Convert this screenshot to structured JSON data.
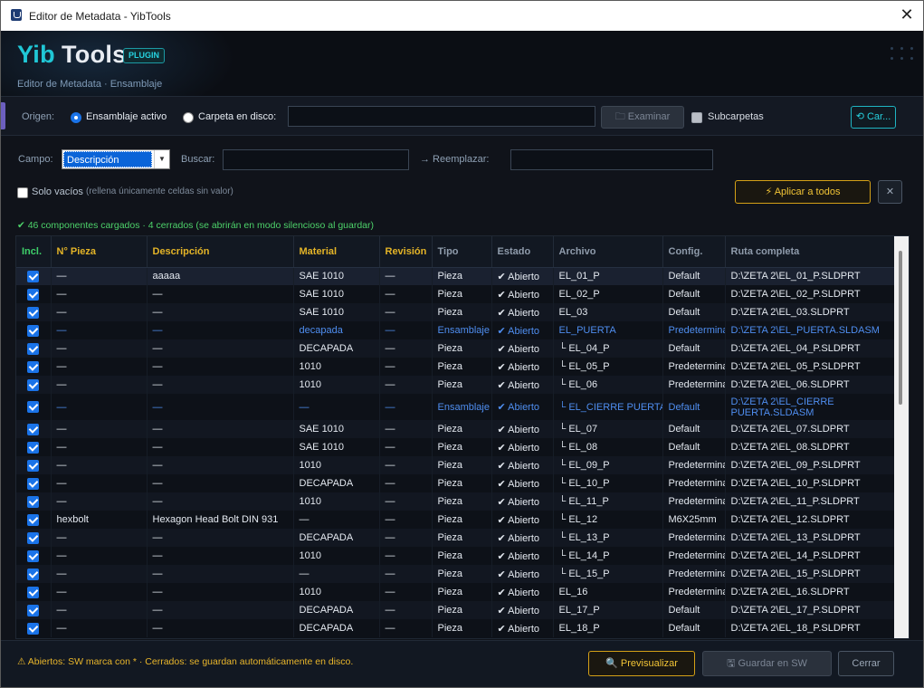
{
  "window": {
    "title": "Editor de Metadata - YibTools",
    "close_icon": "close-icon"
  },
  "header": {
    "logo_part1": "Yib",
    "logo_part2": "Tools",
    "badge": "PLUGIN",
    "subtitle": "Editor de Metadata · Ensamblaje"
  },
  "origin": {
    "label": "Origen:",
    "option_active": "Ensamblaje activo",
    "option_folder": "Carpeta en disco:",
    "selected": "Ensamblaje activo",
    "folder_value": "",
    "browse_label": "🗀 Examinar",
    "subfolders_label": "Subcarpetas",
    "subfolders_checked": false,
    "load_label": "⟲ Car..."
  },
  "field": {
    "label": "Campo:",
    "selected": "Descripción",
    "search_label": "Buscar:",
    "search_value": "",
    "replace_label": "→ Reemplazar:",
    "replace_value": "",
    "empty_only_label": "Solo vacíos",
    "empty_only_hint": "(rellena únicamente celdas sin valor)",
    "empty_only_checked": false,
    "apply_label": "⚡ Aplicar a todos",
    "clear_label": "✕"
  },
  "status": "✔  46 componentes cargados  · 4 cerrados (se abrirán en modo silencioso al guardar)",
  "table": {
    "columns": [
      "Incl.",
      "N° Pieza",
      "Descripción",
      "Material",
      "Revisión",
      "Tipo",
      "Estado",
      "Archivo",
      "Config.",
      "Ruta completa"
    ],
    "rows": [
      {
        "pieza": "—",
        "desc": "aaaaa",
        "mat": "SAE 1010",
        "rev": "—",
        "tipo": "Pieza",
        "estado": "✔ Abierto",
        "archivo": "EL_01_P",
        "config": "Default",
        "ruta": "D:\\ZETA 2\\EL_01_P.SLDPRT",
        "kind": "sel"
      },
      {
        "pieza": "—",
        "desc": "—",
        "mat": "SAE 1010",
        "rev": "—",
        "tipo": "Pieza",
        "estado": "✔ Abierto",
        "archivo": "EL_02_P",
        "config": "Default",
        "ruta": "D:\\ZETA 2\\EL_02_P.SLDPRT",
        "kind": "norm"
      },
      {
        "pieza": "—",
        "desc": "—",
        "mat": "SAE 1010",
        "rev": "—",
        "tipo": "Pieza",
        "estado": "✔ Abierto",
        "archivo": "EL_03",
        "config": "Default",
        "ruta": "D:\\ZETA 2\\EL_03.SLDPRT",
        "kind": "alt"
      },
      {
        "pieza": "—",
        "desc": "—",
        "mat": "decapada",
        "rev": "—",
        "tipo": "Ensamblaje",
        "estado": "✔ Abierto",
        "archivo": "EL_PUERTA",
        "config": "Predetermina",
        "ruta": "D:\\ZETA 2\\EL_PUERTA.SLDASM",
        "kind": "norm asm"
      },
      {
        "pieza": "—",
        "desc": "—",
        "mat": "DECAPADA",
        "rev": "—",
        "tipo": "Pieza",
        "estado": "✔ Abierto",
        "archivo": "└ EL_04_P",
        "config": "Default",
        "ruta": "D:\\ZETA 2\\EL_04_P.SLDPRT",
        "kind": "alt"
      },
      {
        "pieza": "—",
        "desc": "—",
        "mat": "1010",
        "rev": "—",
        "tipo": "Pieza",
        "estado": "✔ Abierto",
        "archivo": "└ EL_05_P",
        "config": "Predetermina",
        "ruta": "D:\\ZETA 2\\EL_05_P.SLDPRT",
        "kind": "norm"
      },
      {
        "pieza": "—",
        "desc": "—",
        "mat": "1010",
        "rev": "—",
        "tipo": "Pieza",
        "estado": "✔ Abierto",
        "archivo": "└ EL_06",
        "config": "Predetermina",
        "ruta": "D:\\ZETA 2\\EL_06.SLDPRT",
        "kind": "alt"
      },
      {
        "pieza": "—",
        "desc": "—",
        "mat": "—",
        "rev": "—",
        "tipo": "Ensamblaje",
        "estado": "✔ Abierto",
        "archivo": "└ EL_CIERRE PUERTA",
        "config": "Default",
        "ruta": "D:\\ZETA 2\\EL_CIERRE PUERTA.SLDASM",
        "kind": "norm asm tall"
      },
      {
        "pieza": "—",
        "desc": "—",
        "mat": "SAE 1010",
        "rev": "—",
        "tipo": "Pieza",
        "estado": "✔ Abierto",
        "archivo": "   └ EL_07",
        "config": "Default",
        "ruta": "D:\\ZETA 2\\EL_07.SLDPRT",
        "kind": "alt"
      },
      {
        "pieza": "—",
        "desc": "—",
        "mat": "SAE 1010",
        "rev": "—",
        "tipo": "Pieza",
        "estado": "✔ Abierto",
        "archivo": "   └ EL_08",
        "config": "Default",
        "ruta": "D:\\ZETA 2\\EL_08.SLDPRT",
        "kind": "norm"
      },
      {
        "pieza": "—",
        "desc": "—",
        "mat": "1010",
        "rev": "—",
        "tipo": "Pieza",
        "estado": "✔ Abierto",
        "archivo": "└ EL_09_P",
        "config": "Predetermina",
        "ruta": "D:\\ZETA 2\\EL_09_P.SLDPRT",
        "kind": "alt"
      },
      {
        "pieza": "—",
        "desc": "—",
        "mat": "DECAPADA",
        "rev": "—",
        "tipo": "Pieza",
        "estado": "✔ Abierto",
        "archivo": "└ EL_10_P",
        "config": "Predetermina",
        "ruta": "D:\\ZETA 2\\EL_10_P.SLDPRT",
        "kind": "norm"
      },
      {
        "pieza": "—",
        "desc": "—",
        "mat": "1010",
        "rev": "—",
        "tipo": "Pieza",
        "estado": "✔ Abierto",
        "archivo": "└ EL_11_P",
        "config": "Predetermina",
        "ruta": "D:\\ZETA 2\\EL_11_P.SLDPRT",
        "kind": "alt"
      },
      {
        "pieza": "hexbolt",
        "desc": "Hexagon Head Bolt DIN 931",
        "mat": "—",
        "rev": "—",
        "tipo": "Pieza",
        "estado": "✔ Abierto",
        "archivo": "└ EL_12",
        "config": "M6X25mm",
        "ruta": "D:\\ZETA 2\\EL_12.SLDPRT",
        "kind": "norm"
      },
      {
        "pieza": "—",
        "desc": "—",
        "mat": "DECAPADA",
        "rev": "—",
        "tipo": "Pieza",
        "estado": "✔ Abierto",
        "archivo": "└ EL_13_P",
        "config": "Predetermina",
        "ruta": "D:\\ZETA 2\\EL_13_P.SLDPRT",
        "kind": "alt"
      },
      {
        "pieza": "—",
        "desc": "—",
        "mat": "1010",
        "rev": "—",
        "tipo": "Pieza",
        "estado": "✔ Abierto",
        "archivo": "└ EL_14_P",
        "config": "Predetermina",
        "ruta": "D:\\ZETA 2\\EL_14_P.SLDPRT",
        "kind": "norm"
      },
      {
        "pieza": "—",
        "desc": "—",
        "mat": "—",
        "rev": "—",
        "tipo": "Pieza",
        "estado": "✔ Abierto",
        "archivo": "└ EL_15_P",
        "config": "Predetermina",
        "ruta": "D:\\ZETA 2\\EL_15_P.SLDPRT",
        "kind": "alt"
      },
      {
        "pieza": "—",
        "desc": "—",
        "mat": "1010",
        "rev": "—",
        "tipo": "Pieza",
        "estado": "✔ Abierto",
        "archivo": "EL_16",
        "config": "Predetermina",
        "ruta": "D:\\ZETA 2\\EL_16.SLDPRT",
        "kind": "norm"
      },
      {
        "pieza": "—",
        "desc": "—",
        "mat": "DECAPADA",
        "rev": "—",
        "tipo": "Pieza",
        "estado": "✔ Abierto",
        "archivo": "EL_17_P",
        "config": "Default",
        "ruta": "D:\\ZETA 2\\EL_17_P.SLDPRT",
        "kind": "alt"
      },
      {
        "pieza": "—",
        "desc": "—",
        "mat": "DECAPADA",
        "rev": "—",
        "tipo": "Pieza",
        "estado": "✔ Abierto",
        "archivo": "EL_18_P",
        "config": "Default",
        "ruta": "D:\\ZETA 2\\EL_18_P.SLDPRT",
        "kind": "norm"
      }
    ]
  },
  "footer": {
    "warning": "⚠  Abiertos: SW marca con * · Cerrados: se guardan automáticamente en disco.",
    "preview_label": "🔍 Previsualizar",
    "save_label": "🖫 Guardar en SW",
    "close_label": "Cerrar"
  },
  "colors": {
    "accent_cyan": "#20c7d6",
    "accent_gold": "#e4b427",
    "status_green": "#4dd26a",
    "assembly_blue": "#4f8ef0",
    "background": "#10131a"
  }
}
